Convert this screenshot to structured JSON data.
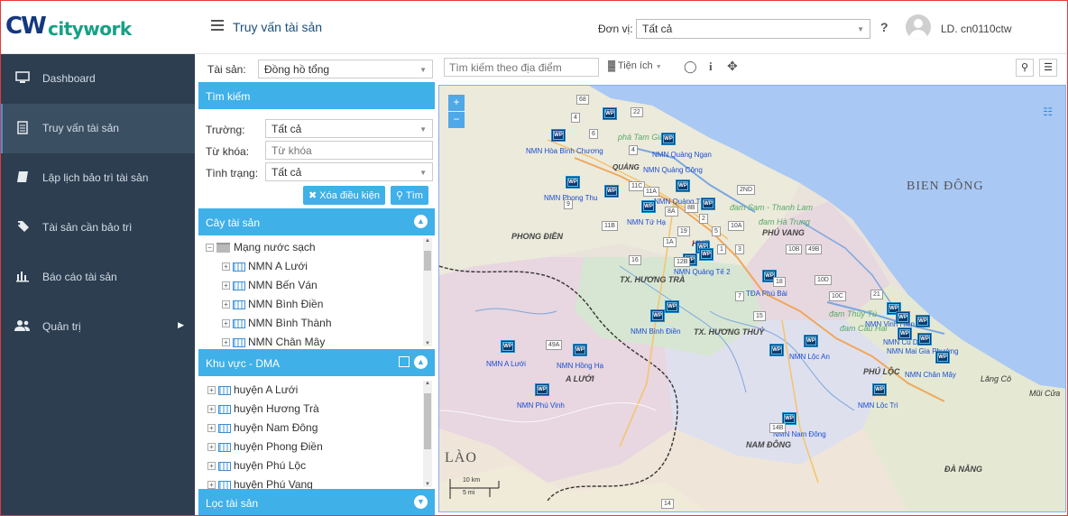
{
  "brand": {
    "logo_mark": "CW",
    "logo_text": "citywork"
  },
  "header": {
    "page_title": "Truy vấn tài sản",
    "unit_label": "Đơn vị:",
    "unit_value": "Tất cả",
    "help": "?",
    "user": "LD. cn0110ctw"
  },
  "sidebar": {
    "items": [
      {
        "label": "Dashboard",
        "icon": "monitor-icon"
      },
      {
        "label": "Truy vấn tài sản",
        "icon": "document-icon",
        "active": true
      },
      {
        "label": "Lập lịch bảo trì tài sản",
        "icon": "book-icon"
      },
      {
        "label": "Tài sản cần bảo trì",
        "icon": "tag-icon"
      },
      {
        "label": "Báo cáo tài sản",
        "icon": "bar-chart-icon"
      },
      {
        "label": "Quản trị",
        "icon": "users-icon",
        "has_submenu": true
      }
    ]
  },
  "panel": {
    "asset_label": "Tài sản:",
    "asset_value": "Đồng hồ tổng",
    "search_header": "Tìm kiếm",
    "field_label": "Trường:",
    "field_value": "Tất cả",
    "keyword_label": "Từ khóa:",
    "keyword_placeholder": "Từ khóa",
    "status_label": "Tình trạng:",
    "status_value": "Tất cả",
    "clear_button": "Xóa điều kiện",
    "search_button": "Tìm",
    "asset_tree_header": "Cây tài sản",
    "asset_tree_root": "Mạng nước sạch",
    "asset_tree_items": [
      "NMN A Lưới",
      "NMN Bến Ván",
      "NMN Bình Điền",
      "NMN Bình Thành",
      "NMN Chân Mây"
    ],
    "dma_header": "Khu vực - DMA",
    "dma_items": [
      "huyện A Lưới",
      "huyện Hương Trà",
      "huyện Nam Đông",
      "huyện Phong Điền",
      "huyện Phú Lộc",
      "huyện Phú Vang"
    ],
    "filter_header": "Lọc tài sản"
  },
  "toolbar": {
    "search_placeholder": "Tìm kiếm theo địa điểm",
    "utilities": "Tiện ích"
  },
  "map": {
    "region_labels": [
      "BIEN ĐÔNG",
      "LÀO",
      "PHONG ĐIỀN",
      "TX. HƯƠNG TRÀ",
      "TX. HƯƠNG THUỶ",
      "PHÚ VANG",
      "A LƯỚI",
      "PHÚ LỘC",
      "NAM ĐÔNG",
      "ĐÀ NẴNG",
      "HUE",
      "QUẢNG"
    ],
    "place_labels": [
      "NMN Hòa Bình Chương",
      "NMN Quảng Ngạn",
      "NMN Quảng Công",
      "NMN Phong Thu",
      "NMN Quảng Tế",
      "NMN Tứ Hạ",
      "NMN Quảng Tế 2",
      "TĐA Phú Bài",
      "NMN Bình Điền",
      "NMN Vinh Hiền",
      "NMN Lộc An",
      "NMN Cù Dù",
      "NMN Mai Gia Phường",
      "NMN Chân Mây",
      "NMN A Lưới",
      "NMN Hồng Hạ",
      "NMN Phú Vinh",
      "NMN Lộc Trì",
      "NMN Nam Đông",
      "đam Sam - Thanh Lam",
      "đam Hà Trung",
      "đam Thủy Tú",
      "đam Cầu Hai",
      "phá Tam Giang",
      "Lăng Cô",
      "Mũi Cửa"
    ],
    "marker_label": "WP",
    "road_numbers": [
      "68",
      "4",
      "22",
      "6",
      "4",
      "11C",
      "11A",
      "8A",
      "8B",
      "2ND",
      "11B",
      "1A",
      "19",
      "5",
      "10A",
      "9",
      "12B",
      "16",
      "49B",
      "10B",
      "18",
      "10D",
      "10C",
      "21",
      "7",
      "15",
      "49A",
      "14B",
      "1",
      "3",
      "2",
      "14"
    ],
    "scale_km": "10 km",
    "scale_mi": "5 mi",
    "zoom_in": "+",
    "zoom_out": "−"
  },
  "colors": {
    "sidebar": "#2c3e50",
    "accent": "#3fb0e8",
    "brand_blue": "#14387f",
    "brand_green": "#16a085",
    "sea": "#a9c8f4"
  }
}
